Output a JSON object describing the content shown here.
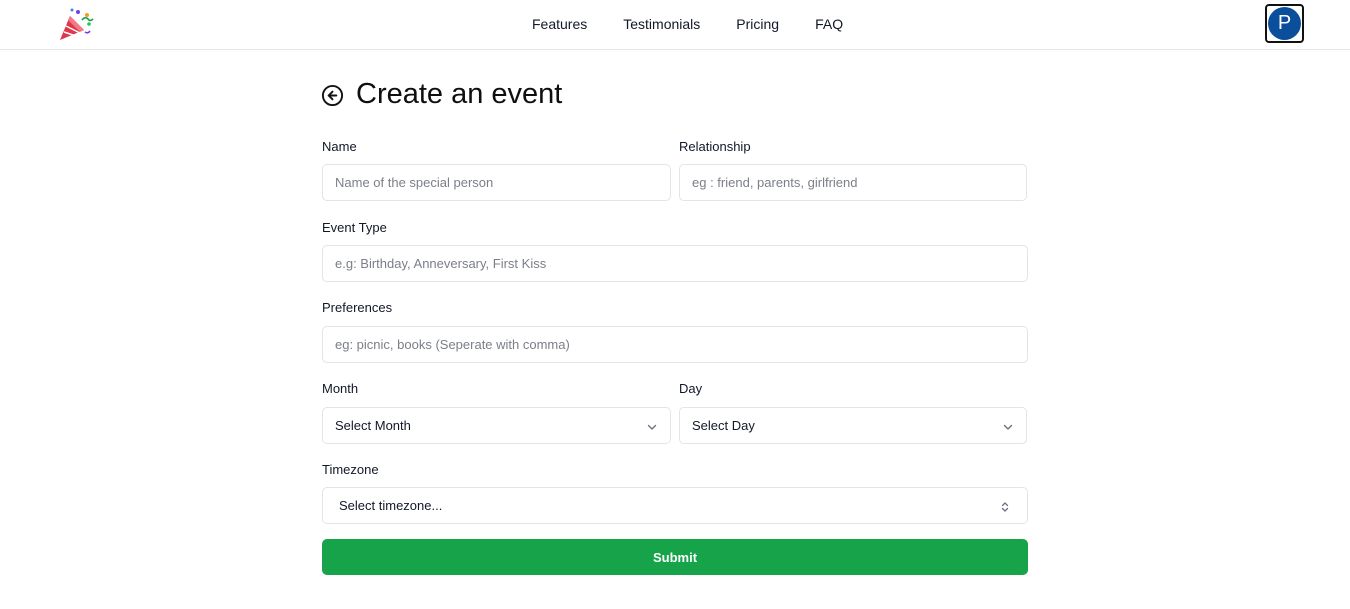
{
  "nav": {
    "logo_icon": "party-popper-icon",
    "links": [
      "Features",
      "Testimonials",
      "Pricing",
      "FAQ"
    ],
    "avatar_initial": "P"
  },
  "page": {
    "back_icon": "arrow-left-circle-icon",
    "title": "Create an event"
  },
  "form": {
    "name": {
      "label": "Name",
      "placeholder": "Name of the special person",
      "value": ""
    },
    "relationship": {
      "label": "Relationship",
      "placeholder": "eg : friend, parents, girlfriend",
      "value": ""
    },
    "event_type": {
      "label": "Event Type",
      "placeholder": "e.g: Birthday, Anneversary, First Kiss",
      "value": ""
    },
    "preferences": {
      "label": "Preferences",
      "placeholder": "eg: picnic, books (Seperate with comma)",
      "value": ""
    },
    "month": {
      "label": "Month",
      "selected": "Select Month"
    },
    "day": {
      "label": "Day",
      "selected": "Select Day"
    },
    "timezone": {
      "label": "Timezone",
      "selected": "Select timezone..."
    },
    "submit_label": "Submit"
  },
  "colors": {
    "accent": "#16a34a",
    "avatar_bg": "#0b4f9c",
    "border": "#e2e4e8"
  }
}
